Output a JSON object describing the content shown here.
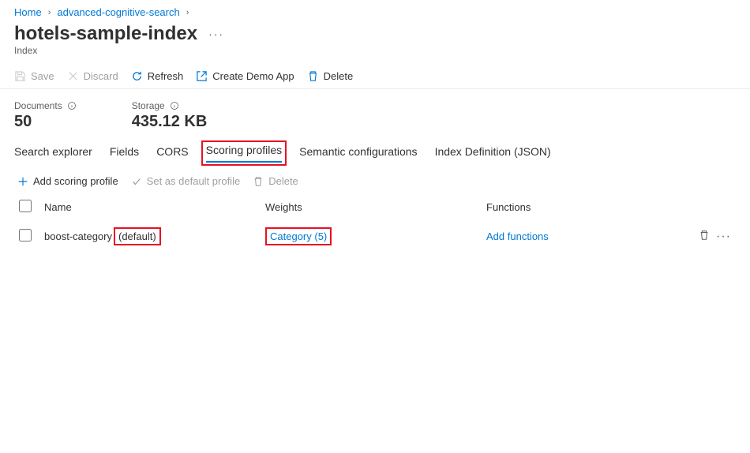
{
  "breadcrumb": {
    "home": "Home",
    "service": "advanced-cognitive-search"
  },
  "page": {
    "title": "hotels-sample-index",
    "subtitle": "Index"
  },
  "toolbar": {
    "save": "Save",
    "discard": "Discard",
    "refresh": "Refresh",
    "create_demo": "Create Demo App",
    "delete": "Delete"
  },
  "stats": {
    "documents_label": "Documents",
    "documents_value": "50",
    "storage_label": "Storage",
    "storage_value": "435.12 KB"
  },
  "tabs": {
    "search_explorer": "Search explorer",
    "fields": "Fields",
    "cors": "CORS",
    "scoring_profiles": "Scoring profiles",
    "semantic": "Semantic configurations",
    "index_def": "Index Definition (JSON)"
  },
  "sub_toolbar": {
    "add": "Add scoring profile",
    "set_default": "Set as default profile",
    "delete": "Delete"
  },
  "table": {
    "headers": {
      "name": "Name",
      "weights": "Weights",
      "functions": "Functions"
    },
    "row": {
      "name_prefix": "boost-category",
      "name_suffix": "(default)",
      "weights": "Category (5)",
      "functions": "Add functions"
    }
  }
}
